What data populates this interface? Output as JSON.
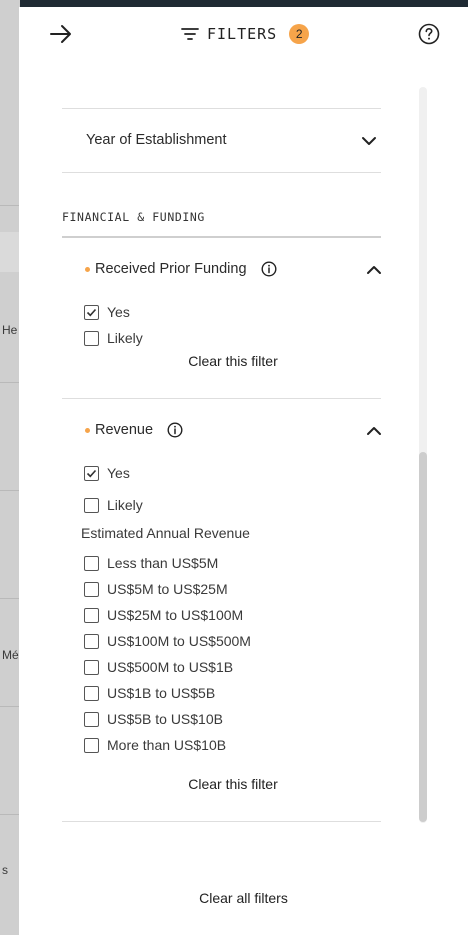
{
  "background": {
    "texts": [
      "He",
      "Méx",
      "s"
    ]
  },
  "header": {
    "title": "FILTERS",
    "badge_count": "2",
    "icons": {
      "back": "arrow-right-icon",
      "filter": "filter-lines-icon",
      "help": "question-circle-icon"
    }
  },
  "accordion_closed": {
    "label": "Year of Establishment"
  },
  "section": {
    "label": "FINANCIAL & FUNDING"
  },
  "prior_funding": {
    "title": "Received Prior Funding",
    "options": [
      {
        "label": "Yes",
        "checked": true
      },
      {
        "label": "Likely",
        "checked": false
      }
    ],
    "clear_label": "Clear this filter"
  },
  "revenue": {
    "title": "Revenue",
    "options": [
      {
        "label": "Yes",
        "checked": true
      },
      {
        "label": "Likely",
        "checked": false
      }
    ],
    "sub_label": "Estimated Annual Revenue",
    "ranges": [
      {
        "label": "Less than US$5M",
        "checked": false
      },
      {
        "label": "US$5M to US$25M",
        "checked": false
      },
      {
        "label": "US$25M to US$100M",
        "checked": false
      },
      {
        "label": "US$100M to US$500M",
        "checked": false
      },
      {
        "label": "US$500M to US$1B",
        "checked": false
      },
      {
        "label": "US$1B to US$5B",
        "checked": false
      },
      {
        "label": "US$5B to US$10B",
        "checked": false
      },
      {
        "label": "More than US$10B",
        "checked": false
      }
    ],
    "clear_label": "Clear this filter"
  },
  "footer": {
    "clear_all_label": "Clear all filters"
  },
  "colors": {
    "accent": "#f6a44a",
    "text": "#2b2b2b",
    "divider": "#dedede"
  }
}
